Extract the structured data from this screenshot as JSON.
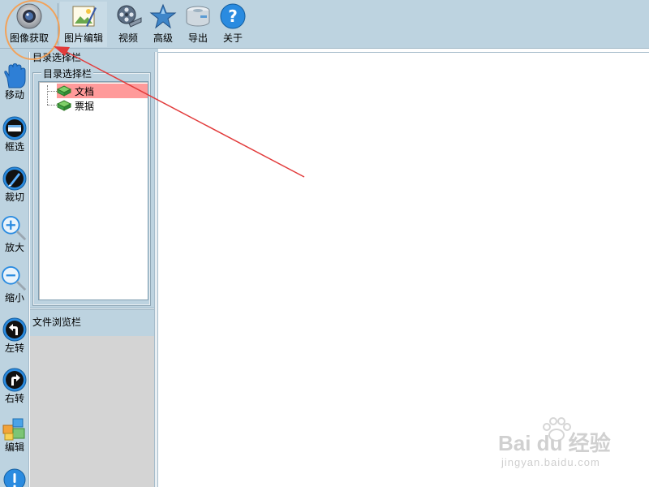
{
  "toolbar": {
    "items": [
      {
        "label": "图像获取",
        "icon": "camera-icon"
      },
      {
        "label": "图片编辑",
        "icon": "image-edit-icon"
      },
      {
        "label": "视频",
        "icon": "film-reel-icon"
      },
      {
        "label": "高级",
        "icon": "star-icon"
      },
      {
        "label": "导出",
        "icon": "disk-export-icon"
      },
      {
        "label": "关于",
        "icon": "help-icon"
      }
    ]
  },
  "left_tools": [
    {
      "label": "移动",
      "icon": "hand-icon"
    },
    {
      "label": "框选",
      "icon": "select-rect-icon"
    },
    {
      "label": "裁切",
      "icon": "crop-icon"
    },
    {
      "label": "放大",
      "icon": "zoom-in-icon"
    },
    {
      "label": "缩小",
      "icon": "zoom-out-icon"
    },
    {
      "label": "左转",
      "icon": "rotate-left-icon"
    },
    {
      "label": "右转",
      "icon": "rotate-right-icon"
    },
    {
      "label": "编辑",
      "icon": "edit-blocks-icon"
    }
  ],
  "directory_panel": {
    "title": "目录选择栏",
    "group_label": "目录选择栏",
    "tree": [
      {
        "label": "文档",
        "selected": true,
        "icon": "book-icon"
      },
      {
        "label": "票据",
        "selected": false,
        "icon": "book-icon"
      }
    ]
  },
  "browse_panel": {
    "title": "文件浏览栏"
  },
  "watermark": {
    "main": "Bai du 经验",
    "sub": "jingyan.baidu.com"
  },
  "colors": {
    "toolbar_bg": "#bdd3e0",
    "selection": "#ff9a9a",
    "annotation_arrow": "#e23b3b",
    "annotation_circle": "#f2a25a"
  }
}
